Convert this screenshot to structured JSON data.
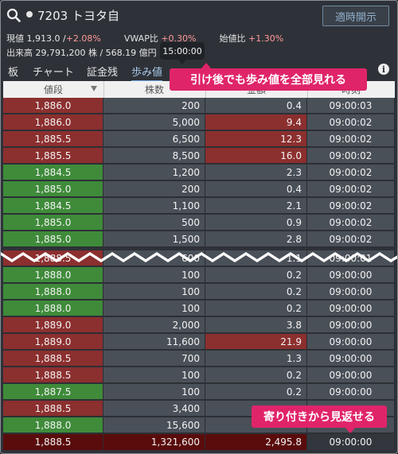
{
  "header": {
    "title": "7203 トヨタ自",
    "notify_button": "適時開示"
  },
  "info": {
    "price_label": "現値",
    "price": "1,913.0 /",
    "price_change": "+2.08%",
    "vwap_label": "VWAP比",
    "vwap_change": "+0.30%",
    "open_label": "始値比",
    "open_change": "+1.30%",
    "volume_label": "出来高",
    "volume": "29,791,200 株 / 568.19 億円"
  },
  "tooltip": "15:00:00",
  "tabs": [
    "板",
    "チャート",
    "証金残",
    "歩み値"
  ],
  "table": {
    "headers": [
      "値段",
      "株数",
      "金額",
      "時刻"
    ],
    "rows": [
      {
        "price": "1,886.0",
        "qty": "200",
        "amount": "0.4",
        "time": "09:00:03",
        "color": "r"
      },
      {
        "price": "1,886.0",
        "qty": "5,000",
        "amount": "9.4",
        "time": "09:00:02",
        "color": "r"
      },
      {
        "price": "1,885.5",
        "qty": "6,500",
        "amount": "12.3",
        "time": "09:00:02",
        "color": "r"
      },
      {
        "price": "1,885.5",
        "qty": "8,500",
        "amount": "16.0",
        "time": "09:00:02",
        "color": "r"
      },
      {
        "price": "1,884.5",
        "qty": "1,200",
        "amount": "2.3",
        "time": "09:00:02",
        "color": "g"
      },
      {
        "price": "1,885.0",
        "qty": "200",
        "amount": "0.4",
        "time": "09:00:02",
        "color": "g"
      },
      {
        "price": "1,884.5",
        "qty": "1,100",
        "amount": "2.1",
        "time": "09:00:02",
        "color": "g"
      },
      {
        "price": "1,885.0",
        "qty": "500",
        "amount": "0.9",
        "time": "09:00:02",
        "color": "g"
      },
      {
        "price": "1,885.0",
        "qty": "1,500",
        "amount": "2.8",
        "time": "09:00:02",
        "color": "g"
      },
      {
        "price": "1,888.5",
        "qty": "600",
        "amount": "1.1",
        "time": "09:00:01",
        "color": "r"
      },
      {
        "price": "1,888.0",
        "qty": "100",
        "amount": "0.2",
        "time": "09:00:00",
        "color": "g"
      },
      {
        "price": "1,888.0",
        "qty": "100",
        "amount": "0.2",
        "time": "09:00:00",
        "color": "g"
      },
      {
        "price": "1,888.0",
        "qty": "100",
        "amount": "0.2",
        "time": "09:00:00",
        "color": "g"
      },
      {
        "price": "1,889.0",
        "qty": "2,000",
        "amount": "3.8",
        "time": "09:00:00",
        "color": "r"
      },
      {
        "price": "1,889.0",
        "qty": "11,600",
        "amount": "21.9",
        "time": "09:00:00",
        "color": "r"
      },
      {
        "price": "1,888.5",
        "qty": "700",
        "amount": "1.3",
        "time": "09:00:00",
        "color": "r"
      },
      {
        "price": "1,888.5",
        "qty": "100",
        "amount": "0.2",
        "time": "09:00:00",
        "color": "r"
      },
      {
        "price": "1,887.5",
        "qty": "100",
        "amount": "0.2",
        "time": "09:00:00",
        "color": "g"
      },
      {
        "price": "1,888.5",
        "qty": "3,400",
        "amount": "",
        "time": "",
        "color": "r"
      },
      {
        "price": "1,888.0",
        "qty": "15,600",
        "amount": "",
        "time": "",
        "color": "g"
      },
      {
        "price": "1,888.5",
        "qty": "1,321,600",
        "amount": "2,495.8",
        "time": "09:00:00",
        "color": "dr"
      }
    ]
  },
  "banners": {
    "top": "引け後でも歩み値を全部見れる",
    "bottom": "寄り付きから見返せる"
  },
  "colors": {
    "sell_red": "#8c2f2f",
    "buy_green": "#3f8b3a",
    "accent_pink": "#e0246a"
  }
}
